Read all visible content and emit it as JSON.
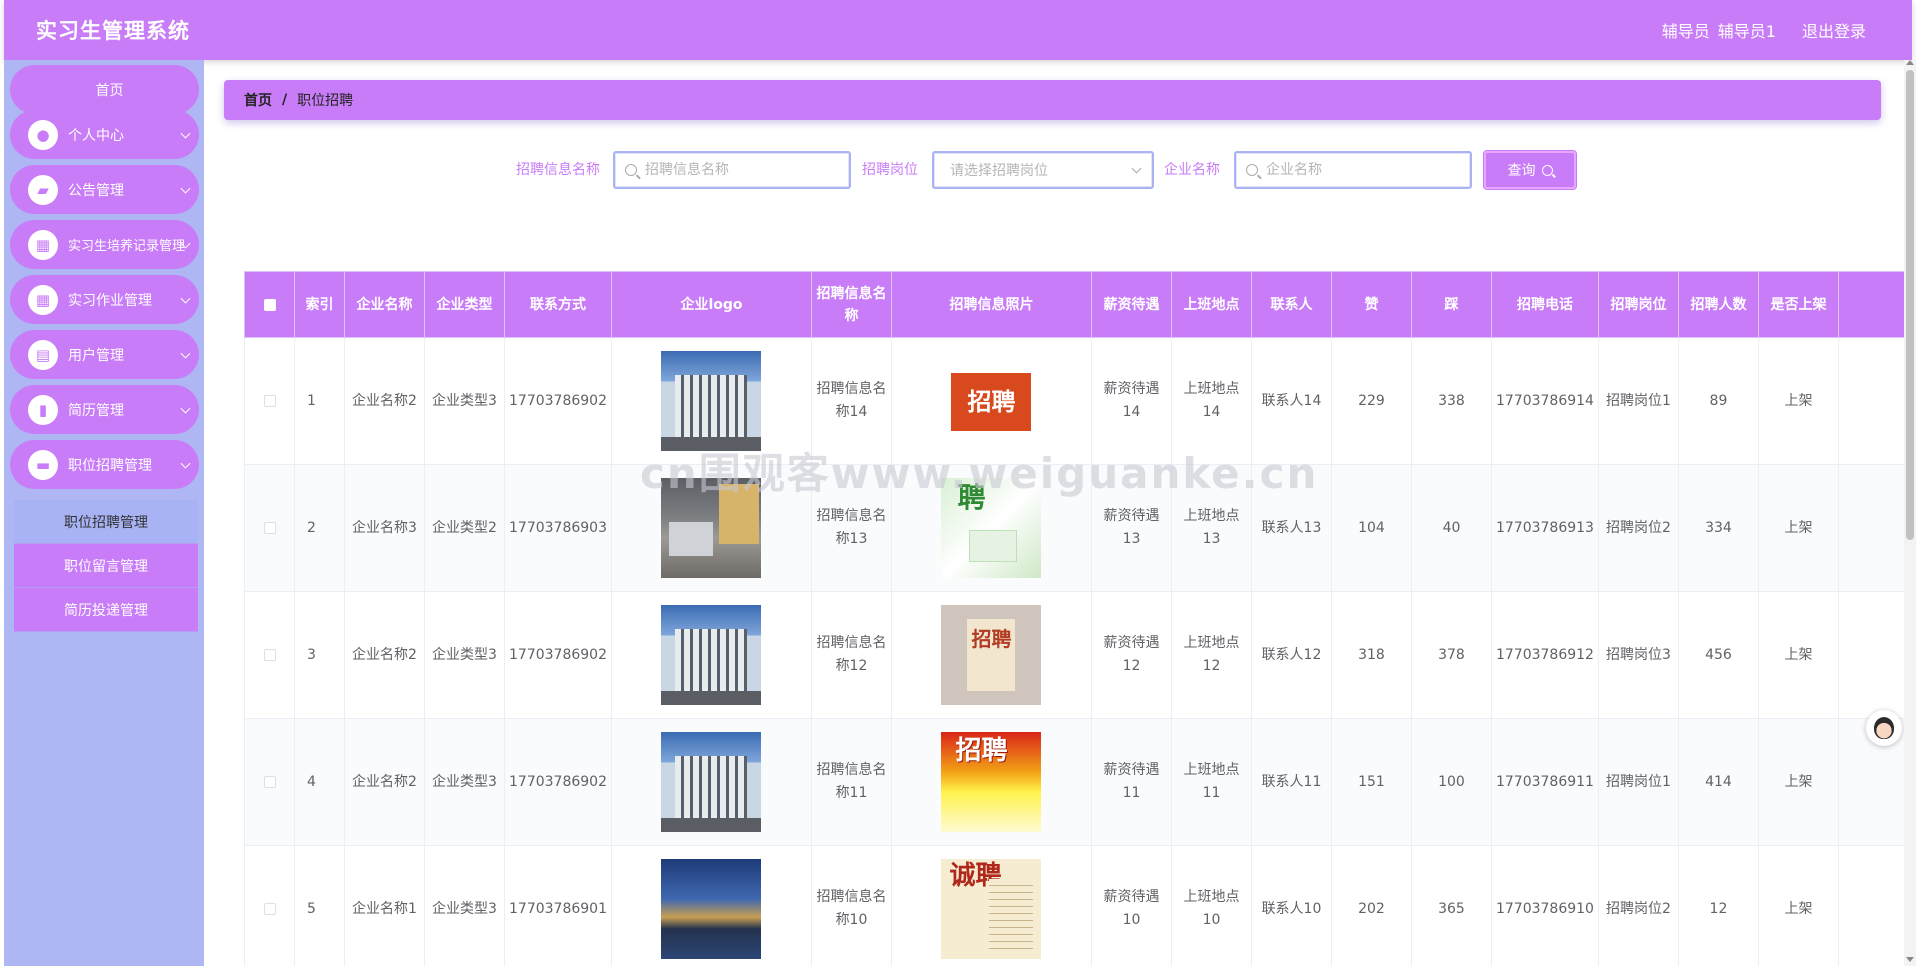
{
  "app": {
    "title": "实习生管理系统"
  },
  "header": {
    "role": "辅导员",
    "username": "辅导员1",
    "logout": "退出登录"
  },
  "sidebar": {
    "home": "首页",
    "items": [
      {
        "label": "个人中心",
        "icon": "user-icon"
      },
      {
        "label": "公告管理",
        "icon": "briefcase-icon"
      },
      {
        "label": "实习生培养记录管理",
        "icon": "building-icon"
      },
      {
        "label": "实习作业管理",
        "icon": "grid-icon"
      },
      {
        "label": "用户管理",
        "icon": "clipboard-icon"
      },
      {
        "label": "简历管理",
        "icon": "bar-chart-icon"
      },
      {
        "label": "职位招聘管理",
        "icon": "bag-icon"
      }
    ],
    "submenu": [
      "职位招聘管理",
      "职位留言管理",
      "简历投递管理"
    ]
  },
  "breadcrumb": {
    "home": "首页",
    "separator": "/",
    "current": "职位招聘"
  },
  "search": {
    "field1_label": "招聘信息名称",
    "field1_placeholder": "招聘信息名称",
    "field2_label": "招聘岗位",
    "field2_placeholder": "请选择招聘岗位",
    "field3_label": "企业名称",
    "field3_placeholder": "企业名称",
    "button": "查询"
  },
  "table": {
    "headers": [
      "索引",
      "企业名称",
      "企业类型",
      "联系方式",
      "企业logo",
      "招聘信息名称",
      "招聘信息照片",
      "薪资待遇",
      "上班地点",
      "联系人",
      "赞",
      "踩",
      "招聘电话",
      "招聘岗位",
      "招聘人数",
      "是否上架"
    ],
    "rows": [
      {
        "index": "1",
        "company": "企业名称2",
        "type": "企业类型3",
        "contact": "17703786902",
        "logo": "building",
        "name": "招聘信息名称14",
        "photo_text": "招聘",
        "salary": "薪资待遇14",
        "location": "上班地点14",
        "person": "联系人14",
        "like": "229",
        "dislike": "338",
        "phone": "17703786914",
        "post": "招聘岗位1",
        "count": "89",
        "status": "上架"
      },
      {
        "index": "2",
        "company": "企业名称3",
        "type": "企业类型2",
        "contact": "17703786903",
        "logo": "office",
        "name": "招聘信息名称13",
        "photo_text": "聘",
        "salary": "薪资待遇13",
        "location": "上班地点13",
        "person": "联系人13",
        "like": "104",
        "dislike": "40",
        "phone": "17703786913",
        "post": "招聘岗位2",
        "count": "334",
        "status": "上架"
      },
      {
        "index": "3",
        "company": "企业名称2",
        "type": "企业类型3",
        "contact": "17703786902",
        "logo": "building",
        "name": "招聘信息名称12",
        "photo_text": "招聘",
        "salary": "薪资待遇12",
        "location": "上班地点12",
        "person": "联系人12",
        "like": "318",
        "dislike": "378",
        "phone": "17703786912",
        "post": "招聘岗位3",
        "count": "456",
        "status": "上架"
      },
      {
        "index": "4",
        "company": "企业名称2",
        "type": "企业类型3",
        "contact": "17703786902",
        "logo": "building",
        "name": "招聘信息名称11",
        "photo_text": "招聘",
        "salary": "薪资待遇11",
        "location": "上班地点11",
        "person": "联系人11",
        "like": "151",
        "dislike": "100",
        "phone": "17703786911",
        "post": "招聘岗位1",
        "count": "414",
        "status": "上架"
      },
      {
        "index": "5",
        "company": "企业名称1",
        "type": "企业类型3",
        "contact": "17703786901",
        "logo": "night",
        "name": "招聘信息名称10",
        "photo_text": "诚聘",
        "salary": "薪资待遇10",
        "location": "上班地点10",
        "person": "联系人10",
        "like": "202",
        "dislike": "365",
        "phone": "17703786910",
        "post": "招聘岗位2",
        "count": "12",
        "status": "上架"
      }
    ]
  },
  "watermark": "cn围观客www.weiguanke.cn",
  "colors": {
    "accent": "#c97cf7",
    "sidebar_bg": "#aeb7f3"
  }
}
